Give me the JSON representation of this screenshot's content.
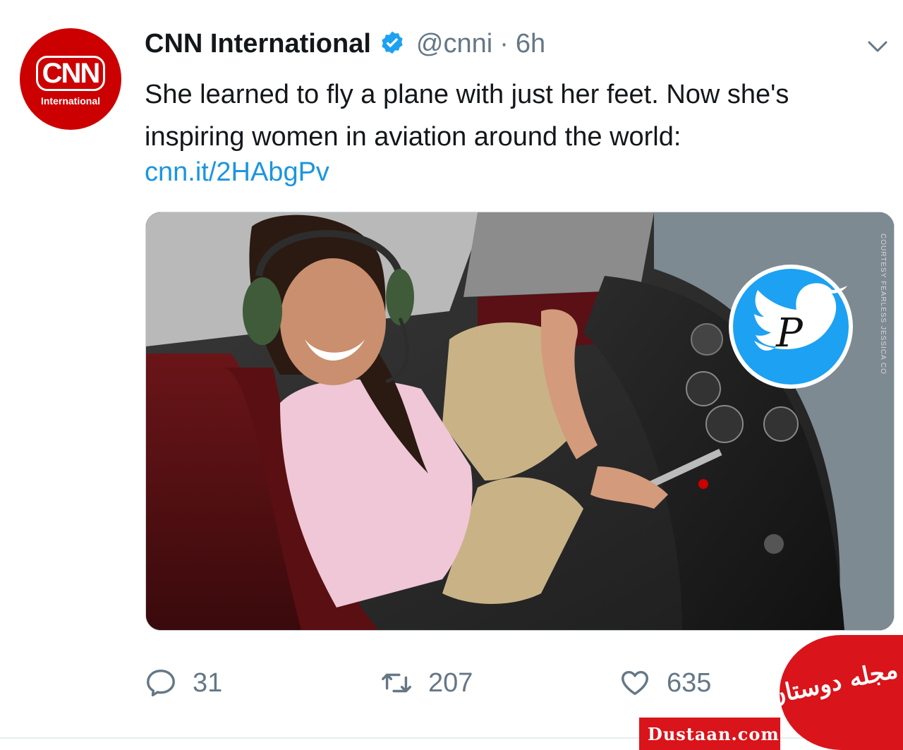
{
  "tweet": {
    "author": {
      "name": "CNN International",
      "handle": "@cnni",
      "separator": "·",
      "time": "6h",
      "verified": true,
      "avatar_logo": "CNN",
      "avatar_sub": "International"
    },
    "text": "She learned to fly a plane with just her feet. Now she's inspiring women in aviation around the world:",
    "link": "cnn.it/2HAbgPv",
    "media": {
      "credit": "COURTESY FEARLESS JESSICA CO"
    },
    "stats": {
      "replies": "31",
      "retweets": "207",
      "likes": "635"
    }
  },
  "watermark": {
    "site": "Dustaan.com",
    "logo_text": "مجله دوستان"
  },
  "colors": {
    "brand_red": "#cc0000",
    "link_blue": "#1b95e0",
    "muted": "#657786",
    "twitter_blue": "#1da1f2"
  }
}
